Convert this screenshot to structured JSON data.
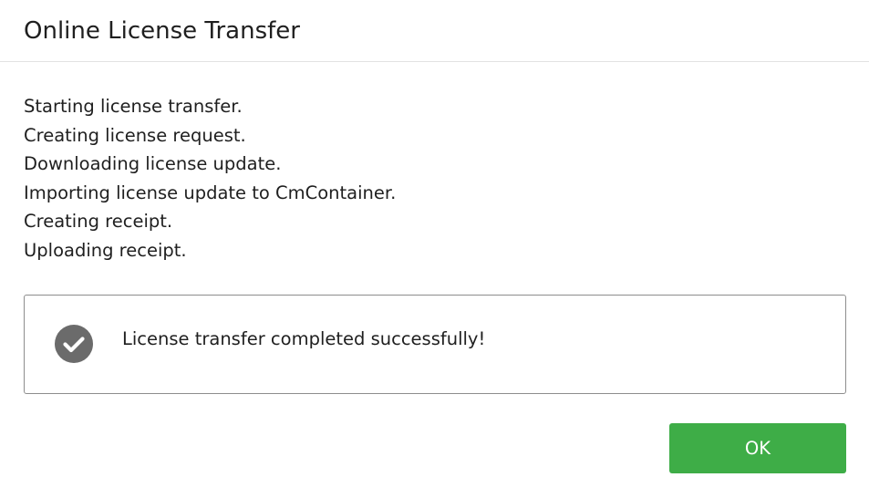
{
  "dialog": {
    "title": "Online License Transfer"
  },
  "log": {
    "lines": [
      "Starting license transfer.",
      "Creating license request.",
      "Downloading license update.",
      "Importing license update to CmContainer.",
      "Creating receipt.",
      "Uploading receipt."
    ]
  },
  "status": {
    "icon": "check-circle-icon",
    "icon_color": "#6b6b6b",
    "message": "License transfer completed successfully!"
  },
  "buttons": {
    "ok_label": "OK",
    "ok_color": "#3ead47"
  }
}
